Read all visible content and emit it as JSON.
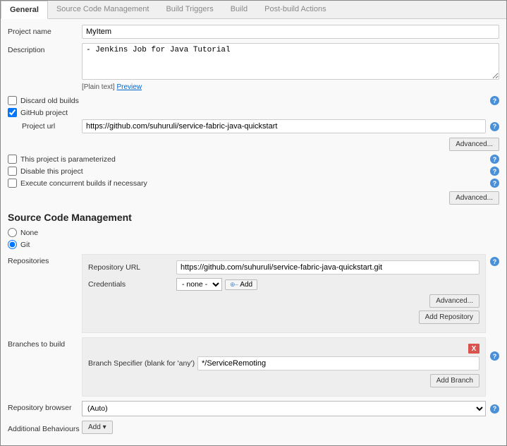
{
  "tabs": {
    "general": "General",
    "scm": "Source Code Management",
    "triggers": "Build Triggers",
    "build": "Build",
    "postbuild": "Post-build Actions"
  },
  "general": {
    "project_name_label": "Project name",
    "project_name_value": "MyItem",
    "description_label": "Description",
    "description_value": "- Jenkins Job for Java Tutorial",
    "plain_text": "[Plain text]",
    "preview": "Preview",
    "discard_old_builds": "Discard old builds",
    "github_project": "GitHub project",
    "project_url_label": "Project url",
    "project_url_value": "https://github.com/suhuruli/service-fabric-java-quickstart",
    "advanced": "Advanced...",
    "parameterized": "This project is parameterized",
    "disable": "Disable this project",
    "concurrent": "Execute concurrent builds if necessary"
  },
  "scm": {
    "heading": "Source Code Management",
    "none": "None",
    "git": "Git",
    "repositories_label": "Repositories",
    "repository_url_label": "Repository URL",
    "repository_url_value": "https://github.com/suhuruli/service-fabric-java-quickstart.git",
    "credentials_label": "Credentials",
    "credentials_value": "- none -",
    "add_btn": "Add",
    "advanced_btn": "Advanced...",
    "add_repository_btn": "Add Repository",
    "branches_label": "Branches to build",
    "branch_specifier_label": "Branch Specifier (blank for 'any')",
    "branch_specifier_value": "*/ServiceRemoting",
    "add_branch_btn": "Add Branch",
    "repository_browser_label": "Repository browser",
    "repository_browser_value": "(Auto)",
    "additional_behaviours_label": "Additional Behaviours",
    "add_dropdown": "Add"
  }
}
